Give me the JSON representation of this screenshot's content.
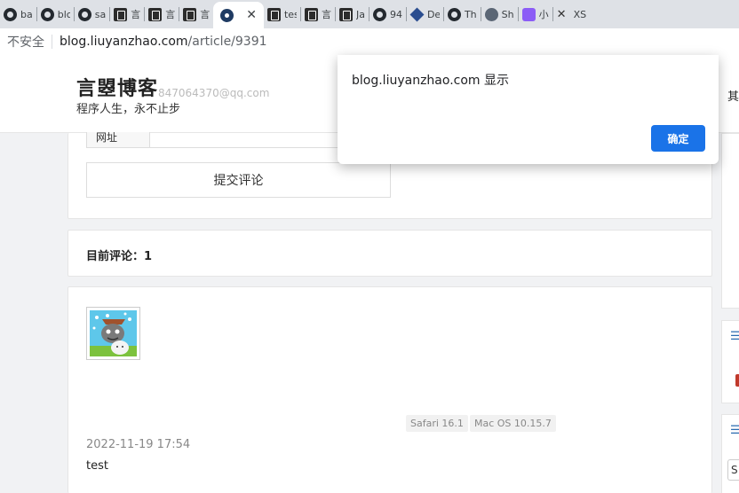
{
  "browser": {
    "tabs": [
      {
        "icon": "github-icon",
        "title": "ba"
      },
      {
        "icon": "github-icon",
        "title": "blc"
      },
      {
        "icon": "github-icon",
        "title": "sa"
      },
      {
        "icon": "blog-icon",
        "title": "言"
      },
      {
        "icon": "blog-icon",
        "title": "言"
      },
      {
        "icon": "blog-icon",
        "title": "言"
      },
      {
        "icon": "eye-icon",
        "title": "",
        "active": true
      },
      {
        "icon": "blog-icon",
        "title": "tes"
      },
      {
        "icon": "blog-icon",
        "title": "言"
      },
      {
        "icon": "blog-icon",
        "title": "Ja"
      },
      {
        "icon": "github-icon",
        "title": "94"
      },
      {
        "icon": "diamond-icon",
        "title": "De"
      },
      {
        "icon": "github-icon",
        "title": "Th"
      },
      {
        "icon": "globe-icon",
        "title": "Sh"
      },
      {
        "icon": "purple-icon",
        "title": "小"
      },
      {
        "icon": "x-icon",
        "title": "XS"
      }
    ],
    "address": {
      "security_label": "不安全",
      "host": "blog.liuyanzhao.com",
      "path": "/article/9391"
    }
  },
  "site": {
    "title": "言曌博客",
    "subtitle": "程序人生，永不止步",
    "email_ghost": "847064370@qq.com",
    "nav_right": "其"
  },
  "comment_form": {
    "url_label": "网址",
    "submit_label": "提交评论"
  },
  "comments_summary": {
    "count_label": "目前评论：1"
  },
  "comment": {
    "browser": "Safari 16.1",
    "os": "Mac OS 10.15.7",
    "date": "2022-11-19 17:54",
    "text": "test"
  },
  "sidebar": {
    "search_partial": "S"
  },
  "dialog": {
    "message": "blog.liuyanzhao.com 显示",
    "ok_label": "确定",
    "ok_color": "#1a73e8"
  }
}
